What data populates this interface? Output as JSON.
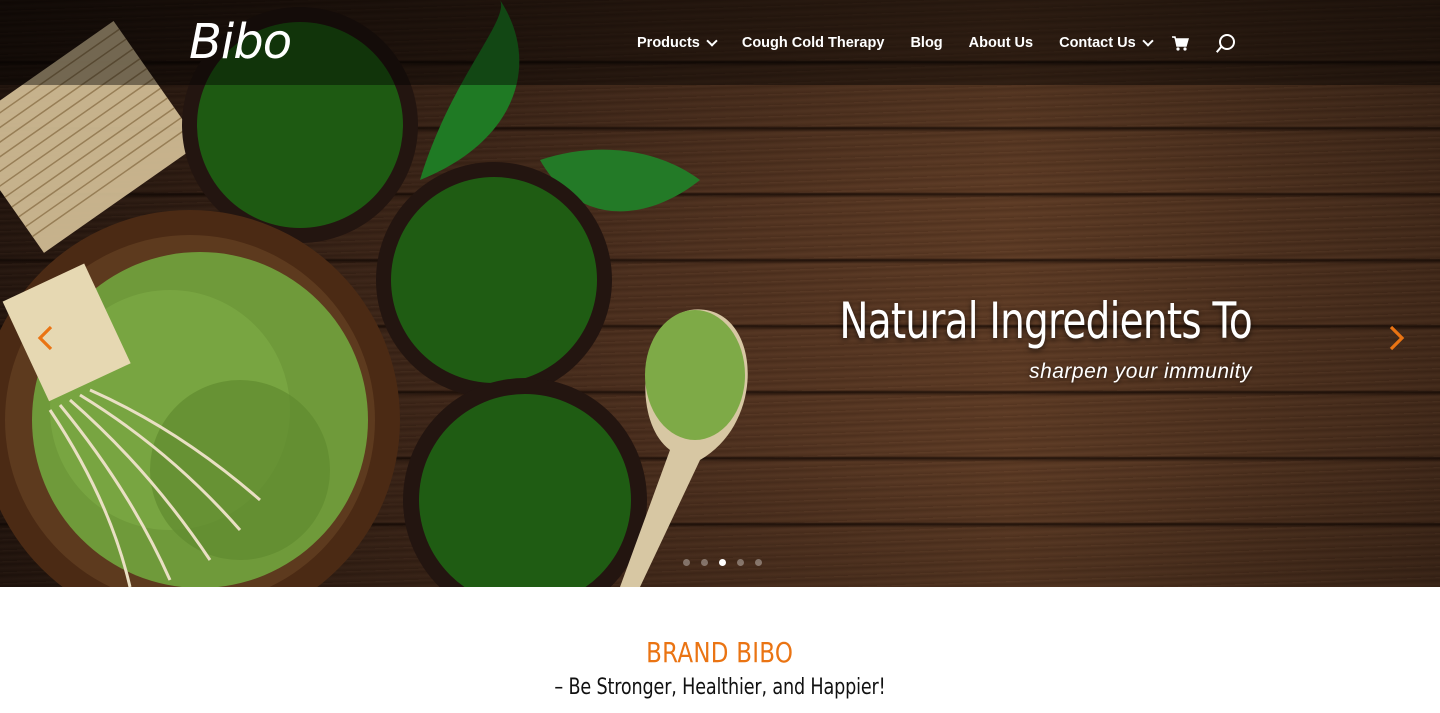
{
  "header": {
    "logo_text": "Bibo",
    "nav": [
      {
        "label": "Products",
        "has_dropdown": true
      },
      {
        "label": "Cough Cold Therapy",
        "has_dropdown": false
      },
      {
        "label": "Blog",
        "has_dropdown": false
      },
      {
        "label": "About Us",
        "has_dropdown": false
      },
      {
        "label": "Contact Us",
        "has_dropdown": true
      }
    ],
    "icons": [
      "cart-icon",
      "search-icon"
    ]
  },
  "slider": {
    "title": "Natural Ingredients To",
    "subtitle": "sharpen your immunity",
    "prev_icon": "chevron-left-icon",
    "next_icon": "chevron-right-icon",
    "slide_count": 5,
    "active_slide": 3
  },
  "section": {
    "title": "BRAND BIBO",
    "subtitle": "– Be Stronger, Healthier, and Happier!"
  },
  "colors": {
    "accent": "#ea7413",
    "header_bg": "rgba(0,0,0,0.42)",
    "text_white": "#ffffff",
    "body_text": "#111111"
  }
}
